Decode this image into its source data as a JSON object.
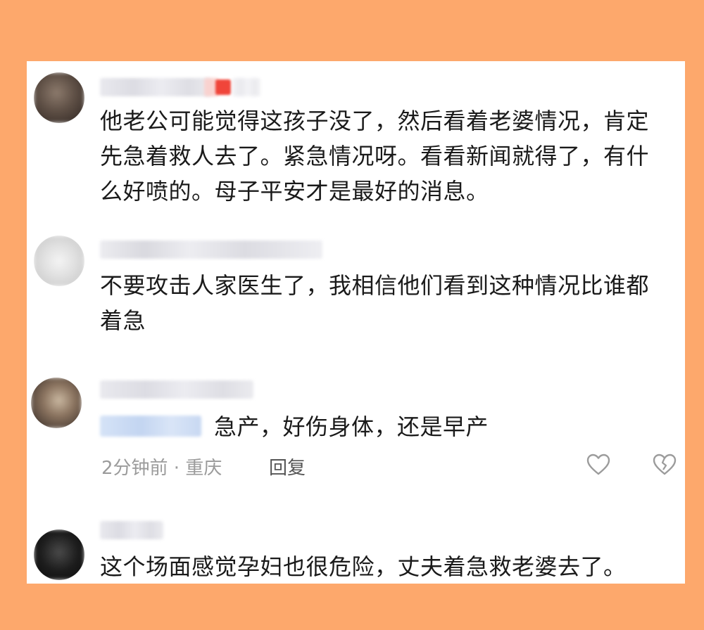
{
  "comments": [
    {
      "text": "他老公可能觉得这孩子没了，然后看着老婆情况，肯定先急着救人去了。紧急情况呀。看看新闻就得了，有什么好喷的。母子平安才是最好的消息。"
    },
    {
      "text": "不要攻击人家医生了，我相信他们看到这种情况比谁都着急"
    },
    {
      "text": "急产，好伤身体，还是早产",
      "time_location": "2分钟前 · 重庆",
      "reply_label": "回复",
      "like_icon": "heart-outline-icon",
      "dislike_icon": "broken-heart-icon"
    },
    {
      "text": "这个场面感觉孕妇也很危险，丈夫着急救老婆去了。"
    }
  ],
  "colors": {
    "background": "#FDA86C",
    "card": "#FFFFFF",
    "text": "#1A1A1A",
    "meta": "#9B9B9B",
    "badge": "#F0453A"
  }
}
